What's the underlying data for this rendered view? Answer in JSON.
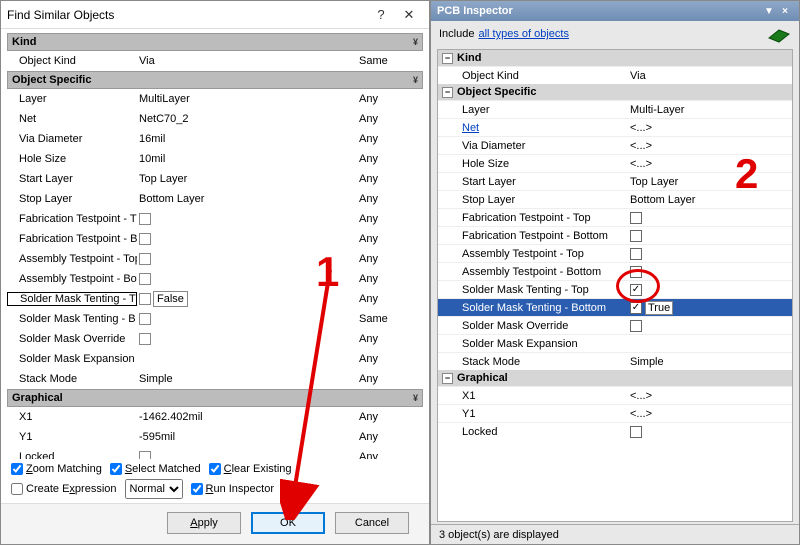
{
  "dialog": {
    "title": "Find Similar Objects",
    "sections": {
      "kind": "Kind",
      "object_specific": "Object Specific",
      "graphical": "Graphical"
    },
    "rows": {
      "object_kind": {
        "label": "Object Kind",
        "val": "Via",
        "match": "Same"
      },
      "layer": {
        "label": "Layer",
        "val": "MultiLayer",
        "match": "Any"
      },
      "net": {
        "label": "Net",
        "val": "NetC70_2",
        "match": "Any"
      },
      "via_diameter": {
        "label": "Via Diameter",
        "val": "16mil",
        "match": "Any"
      },
      "hole_size": {
        "label": "Hole Size",
        "val": "10mil",
        "match": "Any"
      },
      "start_layer": {
        "label": "Start Layer",
        "val": "Top Layer",
        "match": "Any"
      },
      "stop_layer": {
        "label": "Stop Layer",
        "val": "Bottom Layer",
        "match": "Any"
      },
      "fab_tp_top": {
        "label": "Fabrication Testpoint - T",
        "checked": false,
        "match": "Any"
      },
      "fab_tp_bot": {
        "label": "Fabrication Testpoint - B",
        "checked": false,
        "match": "Any"
      },
      "asm_tp_top": {
        "label": "Assembly Testpoint - Top",
        "checked": false,
        "match": "Any"
      },
      "asm_tp_bot": {
        "label": "Assembly Testpoint - Bot",
        "checked": false,
        "match": "Any"
      },
      "smt_top": {
        "label": "Solder Mask Tenting - T",
        "checked": false,
        "val": "False",
        "match": "Any"
      },
      "smt_bot": {
        "label": "Solder Mask Tenting - B",
        "checked": false,
        "match": "Same"
      },
      "sm_override": {
        "label": "Solder Mask Override",
        "checked": false,
        "match": "Any"
      },
      "sm_expansion": {
        "label": "Solder Mask Expansion",
        "val": "",
        "match": "Any"
      },
      "stack_mode": {
        "label": "Stack Mode",
        "val": "Simple",
        "match": "Any"
      },
      "x1": {
        "label": "X1",
        "val": "-1462.402mil",
        "match": "Any"
      },
      "y1": {
        "label": "Y1",
        "val": "-595mil",
        "match": "Any"
      },
      "locked": {
        "label": "Locked",
        "checked": false,
        "match": "Any"
      }
    },
    "opts": {
      "zoom_matching": "Zoom Matching",
      "select_matched": "Select Matched",
      "clear_existing": "Clear Existing",
      "create_expression": "Create Expression",
      "normal": "Normal",
      "run_inspector": "Run Inspector"
    },
    "buttons": {
      "apply": "Apply",
      "ok": "OK",
      "cancel": "Cancel"
    }
  },
  "panel": {
    "title": "PCB Inspector",
    "include_label": "Include",
    "include_link": "all types of objects",
    "sections": {
      "kind": "Kind",
      "object_specific": "Object Specific",
      "graphical": "Graphical"
    },
    "rows": {
      "object_kind": {
        "label": "Object Kind",
        "val": "Via"
      },
      "layer": {
        "label": "Layer",
        "val": "Multi-Layer"
      },
      "net": {
        "label": "Net",
        "val": "<...>"
      },
      "via_diameter": {
        "label": "Via Diameter",
        "val": "<...>"
      },
      "hole_size": {
        "label": "Hole Size",
        "val": "<...>"
      },
      "start_layer": {
        "label": "Start Layer",
        "val": "Top Layer"
      },
      "stop_layer": {
        "label": "Stop Layer",
        "val": "Bottom Layer"
      },
      "fab_tp_top": {
        "label": "Fabrication Testpoint - Top",
        "checked": false
      },
      "fab_tp_bot": {
        "label": "Fabrication Testpoint - Bottom",
        "checked": false
      },
      "asm_tp_top": {
        "label": "Assembly Testpoint - Top",
        "checked": false
      },
      "asm_tp_bot": {
        "label": "Assembly Testpoint - Bottom",
        "checked": false
      },
      "smt_top": {
        "label": "Solder Mask Tenting - Top",
        "checked": true
      },
      "smt_bot": {
        "label": "Solder Mask Tenting - Bottom",
        "checked": true,
        "val": "True"
      },
      "sm_override": {
        "label": "Solder Mask Override",
        "checked": false
      },
      "sm_expansion": {
        "label": "Solder Mask Expansion",
        "val": ""
      },
      "stack_mode": {
        "label": "Stack Mode",
        "val": "Simple"
      },
      "x1": {
        "label": "X1",
        "val": "<...>"
      },
      "y1": {
        "label": "Y1",
        "val": "<...>"
      },
      "locked": {
        "label": "Locked",
        "checked": false
      }
    },
    "status": "3 object(s) are displayed"
  },
  "annotations": {
    "one": "1",
    "two": "2"
  }
}
